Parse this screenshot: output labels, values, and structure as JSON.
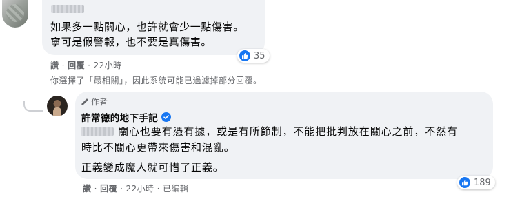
{
  "comment1": {
    "line1": "如果多一點關心，也許就會少一點傷害。",
    "line2": "寧可是假警報，也不要是真傷害。",
    "reaction_count": "35",
    "actions": {
      "like": "讚",
      "sep1": "·",
      "reply": "回覆",
      "sep2": "·",
      "time": "22小時"
    },
    "filter_notice": "你選擇了「最相關」，因此系統可能已過濾掉部分回覆。"
  },
  "reply": {
    "author_badge": "作者",
    "author_name": "許常德的地下手記",
    "line1": "關心也要有憑有據，或是有所節制，不能把批判放在關心之前，不然有",
    "line2": "時比不關心更帶來傷害和混亂。",
    "line3": "正義變成魔人就可惜了正義。",
    "reaction_count": "189",
    "actions": {
      "like": "讚",
      "sep1": "·",
      "reply": "回覆",
      "sep2": "·",
      "time": "22小時",
      "sep3": "·",
      "edited": "已編輯"
    }
  },
  "colors": {
    "bubble": "#f0f2f5",
    "meta": "#65676b",
    "like_blue": "#1877f2"
  },
  "icons": [
    "like-icon",
    "pencil-icon",
    "verified-icon"
  ]
}
